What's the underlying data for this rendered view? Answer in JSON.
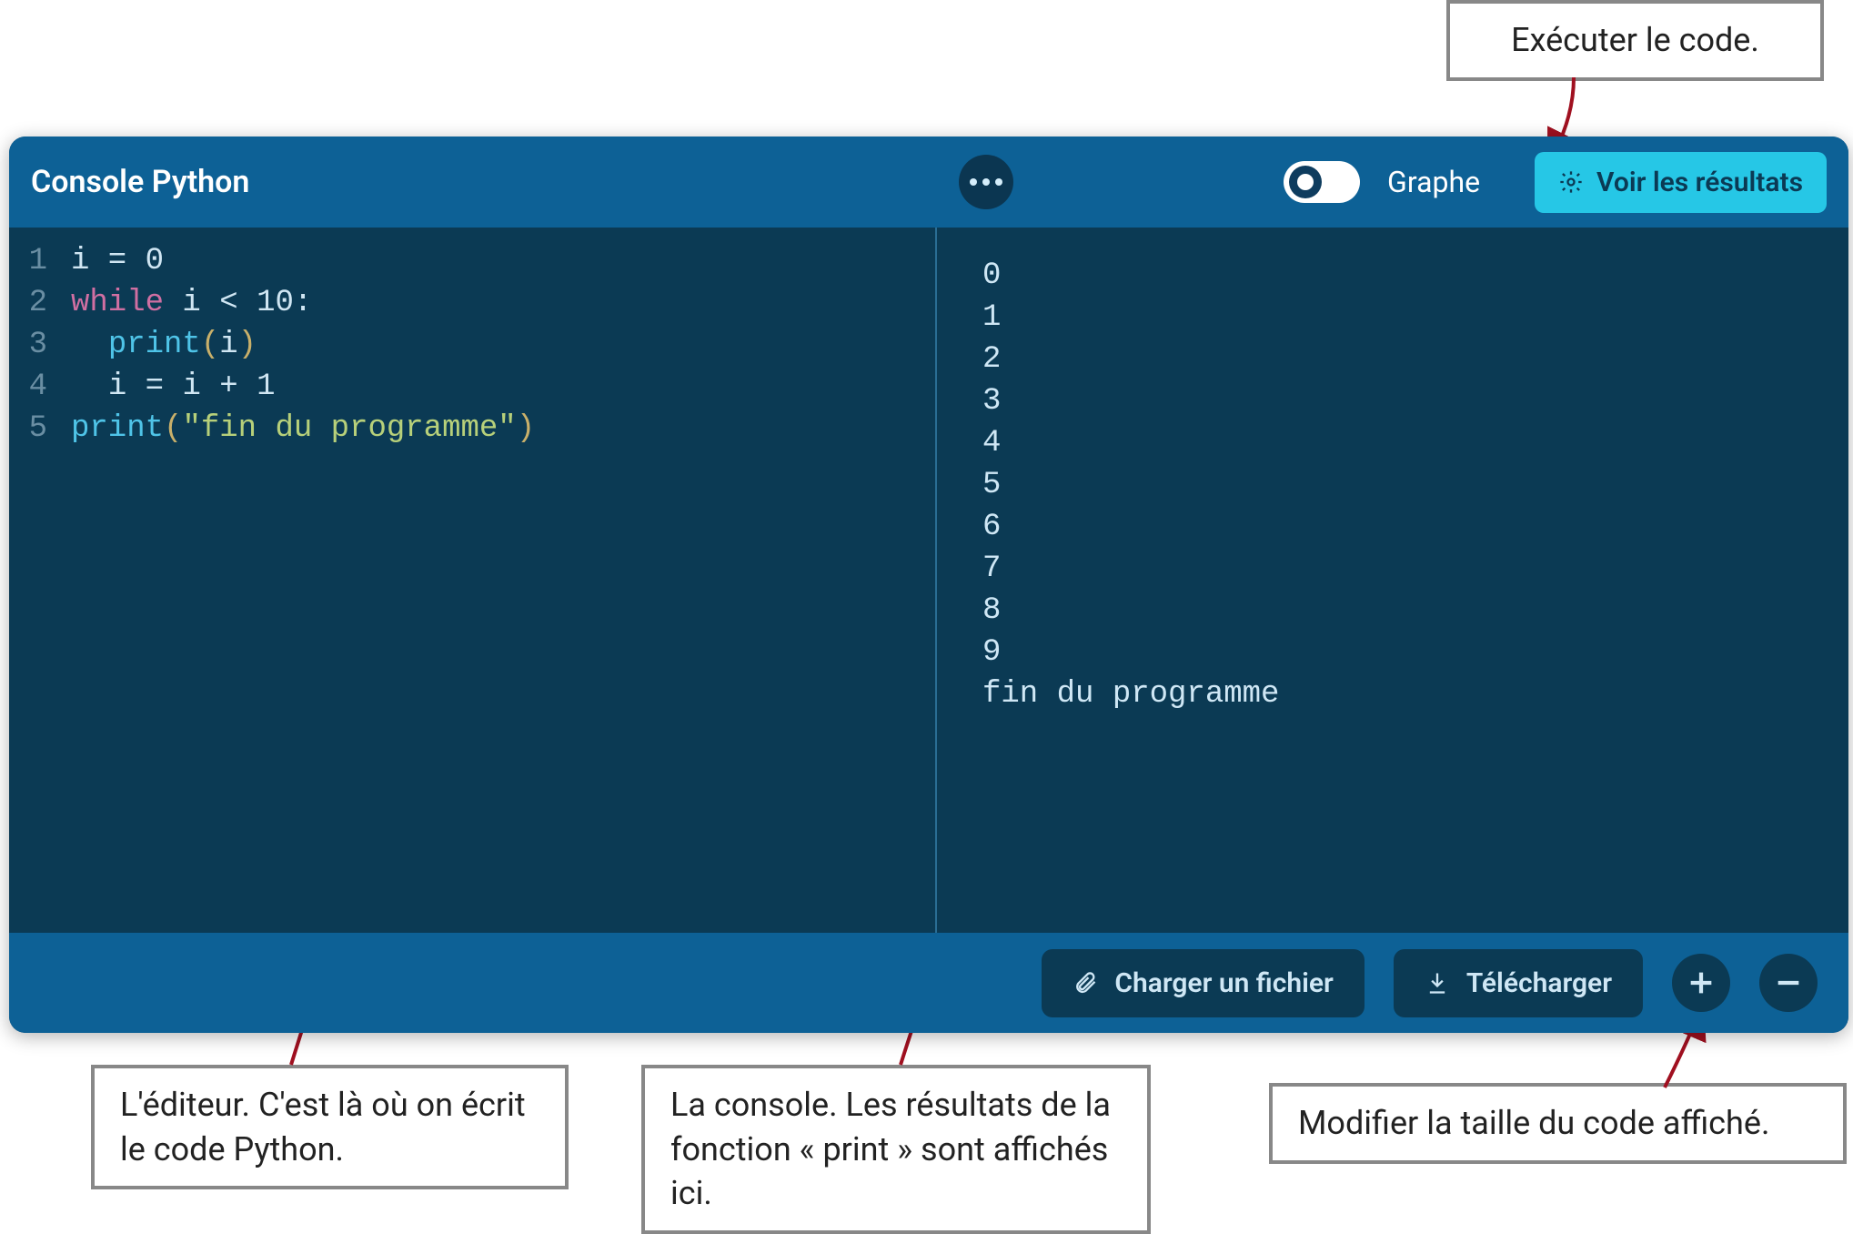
{
  "callouts": {
    "run": "Exécuter le code.",
    "editor": "L'éditeur. C'est là où on écrit le code Python.",
    "console": "La console. Les résultats de la fonction « print » sont affichés ici.",
    "zoom": "Modifier la taille du code affiché."
  },
  "header": {
    "title": "Console Python",
    "toggle_label": "Graphe",
    "run_label": "Voir les résultats"
  },
  "editor": {
    "line_numbers": [
      "1",
      "2",
      "3",
      "4",
      "5"
    ],
    "code_tokens": [
      [
        {
          "t": "var",
          "v": "i"
        },
        {
          "t": "op",
          "v": " = "
        },
        {
          "t": "num",
          "v": "0"
        }
      ],
      [
        {
          "t": "kw",
          "v": "while"
        },
        {
          "t": "var",
          "v": " i "
        },
        {
          "t": "op",
          "v": "< "
        },
        {
          "t": "num",
          "v": "10"
        },
        {
          "t": "op",
          "v": ":"
        }
      ],
      [
        {
          "t": "indent",
          "v": "  "
        },
        {
          "t": "fn",
          "v": "print"
        },
        {
          "t": "paren",
          "v": "("
        },
        {
          "t": "var",
          "v": "i"
        },
        {
          "t": "paren",
          "v": ")"
        }
      ],
      [
        {
          "t": "indent",
          "v": "  "
        },
        {
          "t": "var",
          "v": "i"
        },
        {
          "t": "op",
          "v": " = "
        },
        {
          "t": "var",
          "v": "i"
        },
        {
          "t": "op",
          "v": " + "
        },
        {
          "t": "num",
          "v": "1"
        }
      ],
      [
        {
          "t": "fn",
          "v": "print"
        },
        {
          "t": "paren",
          "v": "("
        },
        {
          "t": "str",
          "v": "\"fin du programme\""
        },
        {
          "t": "paren",
          "v": ")"
        }
      ]
    ]
  },
  "output_lines": [
    "0",
    "1",
    "2",
    "3",
    "4",
    "5",
    "6",
    "7",
    "8",
    "9",
    "fin du programme"
  ],
  "footer": {
    "load_label": "Charger un fichier",
    "download_label": "Télécharger"
  }
}
